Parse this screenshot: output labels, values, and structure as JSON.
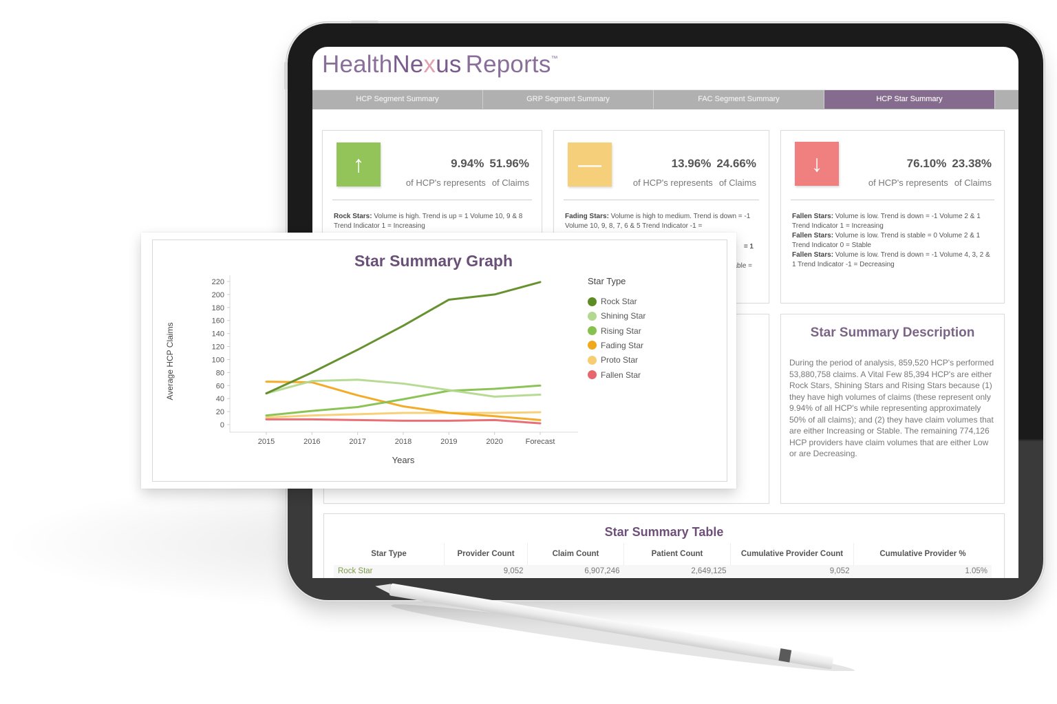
{
  "app": {
    "logo": {
      "part1": "Health",
      "part2a": "Ne",
      "part2x": "x",
      "part2b": "us",
      "part3": "Reports",
      "tm": "™"
    }
  },
  "tabs": [
    {
      "label": "HCP Segment Summary",
      "active": false
    },
    {
      "label": "GRP Segment Summary",
      "active": false
    },
    {
      "label": "FAC Segment Summary",
      "active": false
    },
    {
      "label": "HCP Star Summary",
      "active": true
    }
  ],
  "kpis": [
    {
      "icon": "arrow-up-icon",
      "glyph": "↑",
      "color": "#92c45a",
      "hcp_pct": "9.94%",
      "claims_pct": "51.96%",
      "hcp_label": "of HCP's represents",
      "claims_label": "of Claims",
      "desc": [
        {
          "bold": "Rock Stars:",
          "text": " Volume is high. Trend is up = 1 Volume 10, 9 & 8 Trend Indicator 1 = Increasing"
        }
      ]
    },
    {
      "icon": "dash-icon",
      "glyph": "—",
      "color": "#f6cf7a",
      "hcp_pct": "13.96%",
      "claims_pct": "24.66%",
      "hcp_label": "of HCP's represents",
      "claims_label": "of Claims",
      "desc": [
        {
          "bold": "Fading Stars:",
          "text": " Volume is high to medium. Trend is down = -1 Volume 10, 9, 8, 7, 6 & 5 Trend Indicator -1 ="
        }
      ],
      "partial_lines": [
        "= 1",
        "able ="
      ]
    },
    {
      "icon": "arrow-down-icon",
      "glyph": "↓",
      "color": "#f07f7f",
      "hcp_pct": "76.10%",
      "claims_pct": "23.38%",
      "hcp_label": "of HCP's represents",
      "claims_label": "of Claims",
      "desc": [
        {
          "bold": "Fallen Stars:",
          "text": " Volume is low. Trend is down = -1 Volume 2 & 1 Trend Indicator 1 = Increasing"
        },
        {
          "bold": "Fallen Stars:",
          "text": " Volume is low. Trend is stable = 0 Volume 2 & 1 Trend Indicator 0 = Stable"
        },
        {
          "bold": "Fallen Stars:",
          "text": " Volume is low. Trend is down = -1 Volume 4, 3, 2 & 1 Trend Indicator -1 = Decreasing"
        }
      ]
    }
  ],
  "description": {
    "title": "Star Summary Description",
    "body": "During the period of analysis, 859,520 HCP's performed 53,880,758 claims. A Vital Few 85,394 HCP's are either Rock Stars, Shining Stars and Rising Stars because (1) they have high volumes of claims (these represent only 9.94% of all HCP's while representing approximately 50% of all claims); and (2) they have claim volumes that are either Increasing or Stable. The remaining 774,126 HCP providers have claim volumes that are either Low or are Decreasing."
  },
  "table": {
    "title": "Star Summary Table",
    "columns": [
      "Star Type",
      "Provider Count",
      "Claim Count",
      "Patient Count",
      "Cumulative Provider Count",
      "Cumulative Provider %"
    ],
    "rows": [
      [
        "Rock Star",
        "9,052",
        "6,907,246",
        "2,649,125",
        "9,052",
        "1.05%"
      ]
    ]
  },
  "chart_data": {
    "type": "line",
    "title": "Star Summary Graph",
    "xlabel": "Years",
    "ylabel": "Average HCP Claims",
    "categories": [
      "2015",
      "2016",
      "2017",
      "2018",
      "2019",
      "2020",
      "Forecast"
    ],
    "yticks": [
      0,
      20,
      40,
      60,
      80,
      100,
      120,
      140,
      160,
      180,
      200,
      220
    ],
    "ylim": [
      0,
      220
    ],
    "grid": false,
    "legend_title": "Star Type",
    "legend_position": "right",
    "series": [
      {
        "name": "Rock Star",
        "color": "#5e8c24",
        "values": [
          48,
          80,
          115,
          152,
          192,
          200,
          219
        ]
      },
      {
        "name": "Shining Star",
        "color": "#b3d88f",
        "values": [
          48,
          67,
          69,
          63,
          53,
          43,
          46
        ]
      },
      {
        "name": "Rising Star",
        "color": "#86c04e",
        "values": [
          14,
          21,
          27,
          39,
          52,
          55,
          60
        ]
      },
      {
        "name": "Fading Star",
        "color": "#f2a81d",
        "values": [
          66,
          65,
          45,
          28,
          18,
          13,
          7
        ]
      },
      {
        "name": "Proto Star",
        "color": "#f7cd72",
        "values": [
          11,
          14,
          16,
          18,
          18,
          18,
          19
        ]
      },
      {
        "name": "Fallen Star",
        "color": "#e8666e",
        "values": [
          8,
          8,
          7,
          6,
          6,
          7,
          2
        ]
      }
    ]
  }
}
